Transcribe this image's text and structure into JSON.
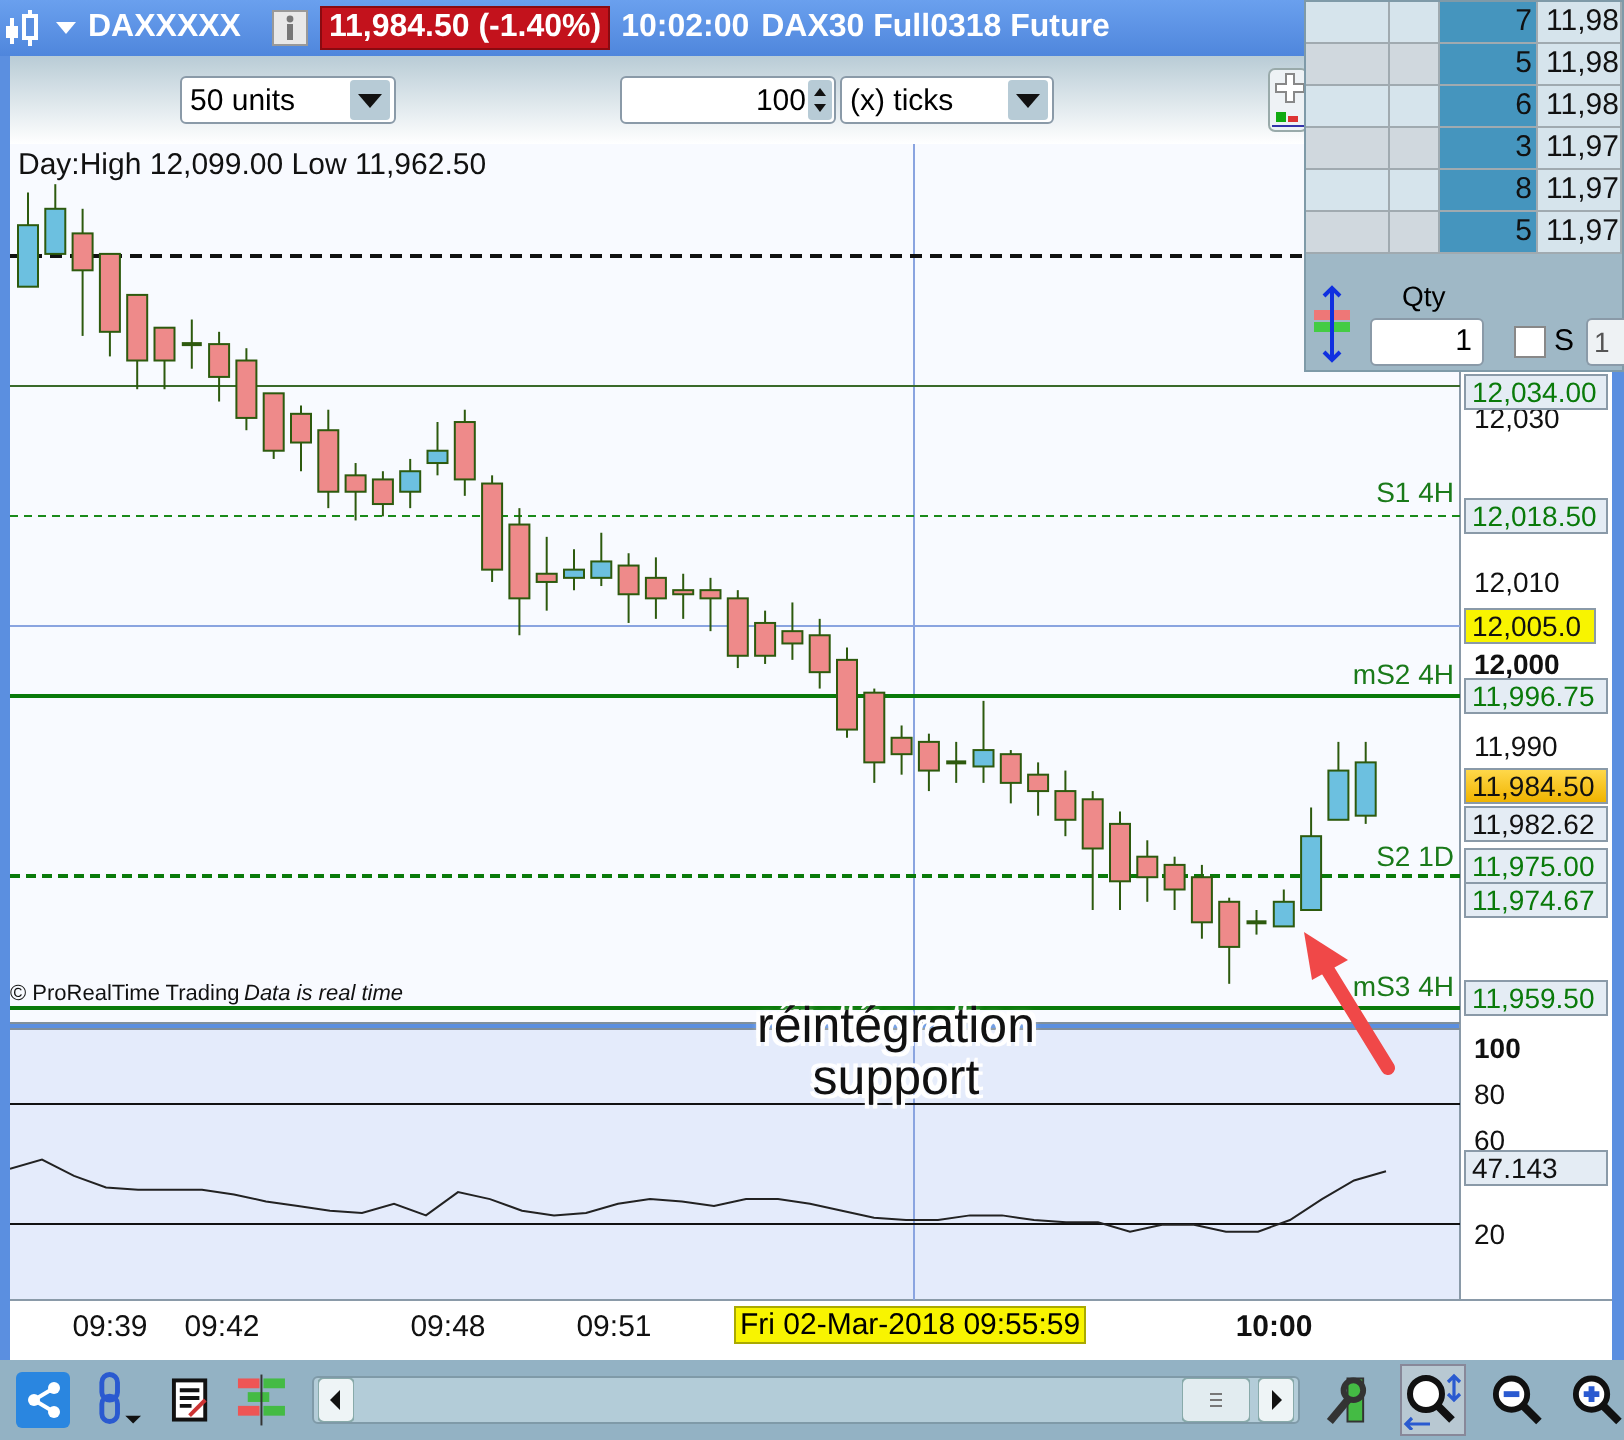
{
  "title_bar": {
    "instrument": "DAXXXXX",
    "price_change": "11,984.50 (-1.40%)",
    "time": "10:02:00",
    "description": "DAX30 Full0318 Future"
  },
  "toolbar": {
    "size_select": "50 units",
    "ticks_value": "100",
    "ticks_select": "(x) ticks"
  },
  "order_book": {
    "rows": [
      {
        "qty": "7",
        "price": "11,98"
      },
      {
        "qty": "5",
        "price": "11,98"
      },
      {
        "qty": "6",
        "price": "11,98"
      },
      {
        "qty": "3",
        "price": "11,97"
      },
      {
        "qty": "8",
        "price": "11,97"
      },
      {
        "qty": "5",
        "price": "11,97"
      }
    ],
    "qty_label": "Qty",
    "qty_value": "1",
    "s_checkbox": {
      "label": "S",
      "checked": false
    },
    "s_value": "1"
  },
  "chart": {
    "day_range": "Day:High 12,099.00 Low 11,962.50",
    "credit": "© ProRealTime Trading",
    "data_note": "Data is real time",
    "chart_data": {
      "type": "candlestick",
      "ylim": [
        11956.1,
        12063.4
      ],
      "yticks": [
        {
          "value": 12030,
          "label": "12,030"
        },
        {
          "value": 12010,
          "label": "12,010"
        },
        {
          "value": 12000,
          "label": "12,000"
        },
        {
          "value": 11990,
          "label": "11,990"
        }
      ],
      "ohlc": [
        [
          12046,
          12057.5,
          12046,
          12053.5
        ],
        [
          12050,
          12058.5,
          12050,
          12055.5
        ],
        [
          12052.5,
          12055.5,
          12040,
          12048
        ],
        [
          12050,
          12050,
          12037.5,
          12040.5
        ],
        [
          12045,
          12045,
          12033.5,
          12037
        ],
        [
          12041,
          12041,
          12033.5,
          12037
        ],
        [
          12039,
          12042,
          12036,
          12039
        ],
        [
          12039,
          12040.5,
          12032,
          12035
        ],
        [
          12037,
          12038.5,
          12028.5,
          12030
        ],
        [
          12033,
          12033,
          12025,
          12026
        ],
        [
          12030.5,
          12031.5,
          12023.5,
          12027
        ],
        [
          12028.5,
          12031,
          12019,
          12021
        ],
        [
          12023,
          12024.5,
          12017.5,
          12021
        ],
        [
          12022.5,
          12023.5,
          12018,
          12019.5
        ],
        [
          12021,
          12025,
          12019,
          12023.5
        ],
        [
          12024.5,
          12029.5,
          12023,
          12026
        ],
        [
          12029.5,
          12031,
          12020.5,
          12022.5
        ],
        [
          12022,
          12023,
          12010,
          12011.5
        ],
        [
          12017,
          12019,
          12003.5,
          12008
        ],
        [
          12011,
          12015.5,
          12006.5,
          12010
        ],
        [
          12010.5,
          12014,
          12009,
          12011.5
        ],
        [
          12010.5,
          12016,
          12009.5,
          12012.5
        ],
        [
          12012,
          12013.5,
          12005,
          12008.5
        ],
        [
          12010.5,
          12013,
          12005.5,
          12008
        ],
        [
          12009,
          12011,
          12005.5,
          12008.5
        ],
        [
          12009,
          12010.5,
          12004,
          12008
        ],
        [
          12008,
          12009,
          11999.5,
          12001
        ],
        [
          12005,
          12006.5,
          12000,
          12001
        ],
        [
          12004,
          12007.5,
          12000.5,
          12002.5
        ],
        [
          12003.5,
          12005.5,
          11997,
          11999
        ],
        [
          12000.5,
          12002,
          11991,
          11992
        ],
        [
          11996.5,
          11997,
          11985.5,
          11988
        ],
        [
          11991,
          11992.5,
          11986.5,
          11989
        ],
        [
          11990.5,
          11991.5,
          11984.5,
          11987
        ],
        [
          11988,
          11990.5,
          11985.5,
          11988
        ],
        [
          11987.5,
          11995.5,
          11985.5,
          11989.5
        ],
        [
          11989,
          11989.5,
          11983,
          11985.5
        ],
        [
          11986.5,
          11988,
          11981.5,
          11984.5
        ],
        [
          11984.5,
          11987,
          11979,
          11981
        ],
        [
          11983.5,
          11984.5,
          11970,
          11977.5
        ],
        [
          11980.5,
          11982,
          11970,
          11973.5
        ],
        [
          11976.5,
          11978.5,
          11971,
          11974
        ],
        [
          11975.5,
          11976.5,
          11970,
          11972.5
        ],
        [
          11974,
          11975.5,
          11966.5,
          11968.5
        ],
        [
          11971,
          11971.5,
          11961,
          11965.5
        ],
        [
          11968.5,
          11970,
          11967,
          11968.5
        ],
        [
          11968,
          11972.5,
          11968,
          11971
        ],
        [
          11970,
          11982.5,
          11970,
          11979
        ],
        [
          11981,
          11990.5,
          11981,
          11987
        ],
        [
          11981.5,
          11990.5,
          11980.5,
          11988
        ]
      ]
    },
    "line_labels": [
      "S1 4H",
      "mS2 4H",
      "S2 1D",
      "mS3 4H"
    ],
    "price_tags": [
      {
        "value": "12,034.00",
        "kind": "level"
      },
      {
        "value": "12,018.50",
        "kind": "level"
      },
      {
        "value": "12,005.0",
        "kind": "cursor"
      },
      {
        "value": "11,996.75",
        "kind": "level"
      },
      {
        "value": "11,984.50",
        "kind": "last"
      },
      {
        "value": "11,982.62",
        "kind": "average"
      },
      {
        "value": "11,975.00",
        "kind": "level"
      },
      {
        "value": "11,974.67",
        "kind": "level"
      },
      {
        "value": "11,959.50",
        "kind": "level"
      }
    ],
    "annotation": "réintégration support"
  },
  "indicator": {
    "chart_data": {
      "type": "line",
      "ylim": [
        -8.4,
        108.6
      ],
      "yticks": [
        20,
        60,
        80,
        100
      ],
      "series": [
        {
          "color": "#222222",
          "values": [
            48,
            52,
            45,
            40,
            39,
            39,
            39,
            37,
            34,
            32,
            30,
            29,
            33,
            28,
            38,
            35,
            30,
            28,
            29,
            33,
            35,
            34,
            32,
            35,
            35,
            33,
            30,
            27,
            26,
            26,
            28,
            28,
            26,
            25,
            25,
            21,
            24,
            24,
            21,
            21,
            26,
            35,
            43,
            47
          ]
        }
      ]
    },
    "value_tag": "47.143"
  },
  "time_axis": {
    "labels": [
      {
        "label": "09:39",
        "bold": false
      },
      {
        "label": "09:42",
        "bold": false
      },
      {
        "label": "09:48",
        "bold": false
      },
      {
        "label": "09:51",
        "bold": false
      },
      {
        "label": "10:00",
        "bold": true
      }
    ],
    "cursor_time": "Fri 02-Mar-2018 09:55:59"
  }
}
